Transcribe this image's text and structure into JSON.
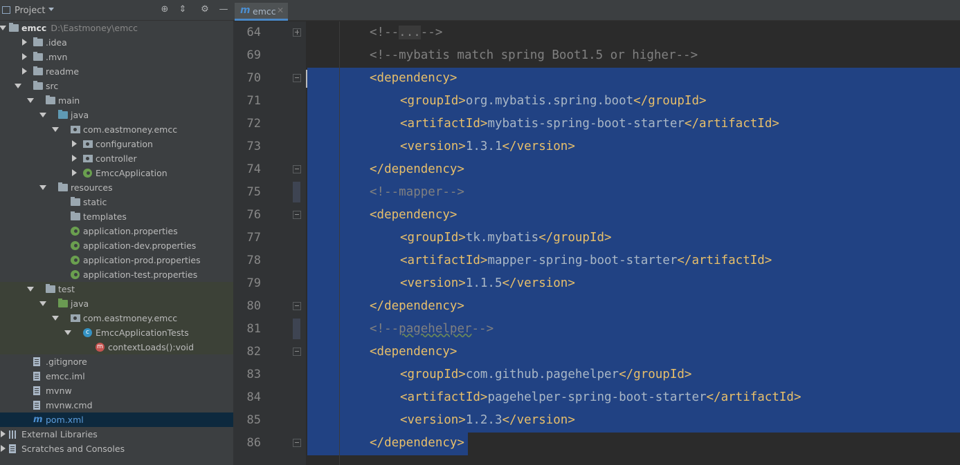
{
  "project_panel": {
    "title": "Project",
    "tree": [
      {
        "label": "emcc",
        "path": "D:\\Eastmoney\\emcc",
        "depth": 0,
        "expanded": true,
        "icon": "module-folder-icon"
      },
      {
        "label": ".idea",
        "depth": 1,
        "expanded": false,
        "icon": "folder-icon"
      },
      {
        "label": ".mvn",
        "depth": 1,
        "expanded": false,
        "icon": "folder-icon"
      },
      {
        "label": "readme",
        "depth": 1,
        "expanded": false,
        "icon": "folder-icon"
      },
      {
        "label": "src",
        "depth": 1,
        "expanded": true,
        "icon": "folder-icon"
      },
      {
        "label": "main",
        "depth": 2,
        "expanded": true,
        "icon": "folder-icon"
      },
      {
        "label": "java",
        "depth": 3,
        "expanded": true,
        "icon": "source-folder-icon"
      },
      {
        "label": "com.eastmoney.emcc",
        "depth": 4,
        "expanded": true,
        "icon": "package-icon"
      },
      {
        "label": "configuration",
        "depth": 5,
        "expanded": false,
        "icon": "package-icon"
      },
      {
        "label": "controller",
        "depth": 5,
        "expanded": false,
        "icon": "package-icon"
      },
      {
        "label": "EmccApplication",
        "depth": 5,
        "expanded": false,
        "icon": "spring-boot-icon"
      },
      {
        "label": "resources",
        "depth": 3,
        "expanded": true,
        "icon": "resources-folder-icon"
      },
      {
        "label": "static",
        "depth": 4,
        "icon": "folder-icon"
      },
      {
        "label": "templates",
        "depth": 4,
        "icon": "folder-icon"
      },
      {
        "label": "application.properties",
        "depth": 4,
        "icon": "spring-properties-icon"
      },
      {
        "label": "application-dev.properties",
        "depth": 4,
        "icon": "spring-properties-icon"
      },
      {
        "label": "application-prod.properties",
        "depth": 4,
        "icon": "spring-properties-icon"
      },
      {
        "label": "application-test.properties",
        "depth": 4,
        "icon": "spring-properties-icon"
      },
      {
        "label": "test",
        "depth": 2,
        "expanded": true,
        "icon": "folder-icon"
      },
      {
        "label": "java",
        "depth": 3,
        "expanded": true,
        "icon": "test-source-folder-icon"
      },
      {
        "label": "com.eastmoney.emcc",
        "depth": 4,
        "expanded": true,
        "icon": "package-icon"
      },
      {
        "label": "EmccApplicationTests",
        "depth": 5,
        "expanded": true,
        "icon": "class-icon"
      },
      {
        "label": "contextLoads():void",
        "depth": 6,
        "icon": "method-icon"
      },
      {
        "label": ".gitignore",
        "depth": 1,
        "icon": "file-icon"
      },
      {
        "label": "emcc.iml",
        "depth": 1,
        "icon": "file-icon"
      },
      {
        "label": "mvnw",
        "depth": 1,
        "icon": "file-icon"
      },
      {
        "label": "mvnw.cmd",
        "depth": 1,
        "icon": "file-icon"
      },
      {
        "label": "pom.xml",
        "depth": 1,
        "icon": "maven-icon",
        "selected": true
      },
      {
        "label": "External Libraries",
        "depth": 0,
        "expanded": false,
        "icon": "libraries-icon"
      },
      {
        "label": "Scratches and Consoles",
        "depth": 0,
        "expanded": false,
        "icon": "scratches-icon"
      }
    ]
  },
  "editor": {
    "tab": {
      "label": "emcc",
      "icon": "maven-icon"
    },
    "lines": [
      {
        "num": "64",
        "fold": "plus",
        "segments": [
          {
            "t": "<!--",
            "c": "cmt"
          },
          {
            "t": "...",
            "c": "fold-ph"
          },
          {
            "t": "-->",
            "c": "cmt"
          }
        ]
      },
      {
        "num": "69",
        "segments": [
          {
            "t": "<!--mybatis match spring Boot1.5 or higher-->",
            "c": "cmt"
          }
        ]
      },
      {
        "num": "70",
        "fold": "minus",
        "segments": [
          {
            "t": "<dependency>",
            "c": "tag"
          }
        ]
      },
      {
        "num": "71",
        "segments": [
          {
            "t": "<groupId>",
            "c": "tag"
          },
          {
            "t": "org.mybatis.spring.boot",
            "c": "txt"
          },
          {
            "t": "</groupId>",
            "c": "tag"
          }
        ]
      },
      {
        "num": "72",
        "segments": [
          {
            "t": "<artifactId>",
            "c": "tag"
          },
          {
            "t": "mybatis-spring-boot-starter",
            "c": "txt"
          },
          {
            "t": "</artifactId>",
            "c": "tag"
          }
        ]
      },
      {
        "num": "73",
        "segments": [
          {
            "t": "<version>",
            "c": "tag"
          },
          {
            "t": "1.3.1",
            "c": "txt"
          },
          {
            "t": "</version>",
            "c": "tag"
          }
        ]
      },
      {
        "num": "74",
        "fold": "minus",
        "segments": [
          {
            "t": "</dependency>",
            "c": "tag"
          }
        ]
      },
      {
        "num": "75",
        "mark": true,
        "segments": [
          {
            "t": "<!--mapper-->",
            "c": "cmt"
          }
        ]
      },
      {
        "num": "76",
        "fold": "minus",
        "segments": [
          {
            "t": "<dependency>",
            "c": "tag"
          }
        ]
      },
      {
        "num": "77",
        "segments": [
          {
            "t": "<groupId>",
            "c": "tag"
          },
          {
            "t": "tk.mybatis",
            "c": "txt"
          },
          {
            "t": "</groupId>",
            "c": "tag"
          }
        ]
      },
      {
        "num": "78",
        "segments": [
          {
            "t": "<artifactId>",
            "c": "tag"
          },
          {
            "t": "mapper-spring-boot-starter",
            "c": "txt"
          },
          {
            "t": "</artifactId>",
            "c": "tag"
          }
        ]
      },
      {
        "num": "79",
        "segments": [
          {
            "t": "<version>",
            "c": "tag"
          },
          {
            "t": "1.1.5",
            "c": "txt"
          },
          {
            "t": "</version>",
            "c": "tag"
          }
        ]
      },
      {
        "num": "80",
        "fold": "minus",
        "segments": [
          {
            "t": "</dependency>",
            "c": "tag"
          }
        ]
      },
      {
        "num": "81",
        "mark": true,
        "segments": [
          {
            "t": "<!--",
            "c": "cmt"
          },
          {
            "t": "pagehelper",
            "c": "cmt squiggle"
          },
          {
            "t": "-->",
            "c": "cmt"
          }
        ]
      },
      {
        "num": "82",
        "fold": "minus",
        "segments": [
          {
            "t": "<dependency>",
            "c": "tag"
          }
        ]
      },
      {
        "num": "83",
        "segments": [
          {
            "t": "<groupId>",
            "c": "tag"
          },
          {
            "t": "com.github.pagehelper",
            "c": "txt"
          },
          {
            "t": "</groupId>",
            "c": "tag"
          }
        ]
      },
      {
        "num": "84",
        "segments": [
          {
            "t": "<artifactId>",
            "c": "tag"
          },
          {
            "t": "pagehelper-spring-boot-starter",
            "c": "txt"
          },
          {
            "t": "</artifactId>",
            "c": "tag"
          }
        ]
      },
      {
        "num": "85",
        "segments": [
          {
            "t": "<version>",
            "c": "tag"
          },
          {
            "t": "1.2.3",
            "c": "txt"
          },
          {
            "t": "</version>",
            "c": "tag"
          }
        ]
      },
      {
        "num": "86",
        "fold": "minus",
        "segments": [
          {
            "t": "</dependency>",
            "c": "tag"
          }
        ]
      }
    ]
  }
}
